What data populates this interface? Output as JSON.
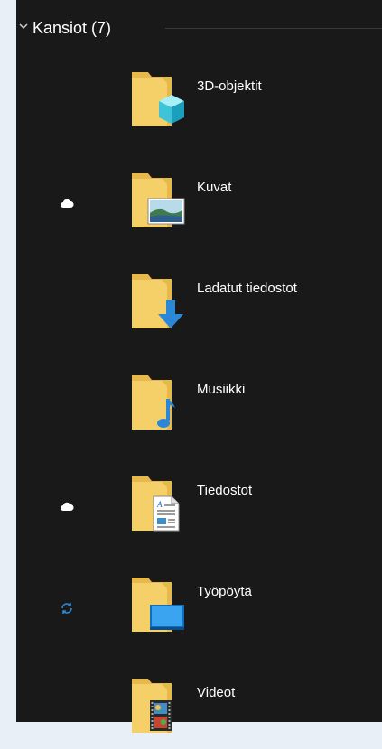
{
  "header": {
    "title": "Kansiot (7)"
  },
  "folders": [
    {
      "label": "3D-objektit",
      "overlay_icon": "cube-icon",
      "status_icon": null
    },
    {
      "label": "Kuvat",
      "overlay_icon": "picture-icon",
      "status_icon": "cloud-icon"
    },
    {
      "label": "Ladatut tiedostot",
      "overlay_icon": "download-arrow-icon",
      "status_icon": null
    },
    {
      "label": "Musiikki",
      "overlay_icon": "music-note-icon",
      "status_icon": null
    },
    {
      "label": "Tiedostot",
      "overlay_icon": "document-icon",
      "status_icon": "cloud-icon"
    },
    {
      "label": "Työpöytä",
      "overlay_icon": "desktop-icon",
      "status_icon": "sync-icon"
    },
    {
      "label": "Videot",
      "overlay_icon": "film-strip-icon",
      "status_icon": null
    }
  ],
  "colors": {
    "background": "#191919",
    "outer_background": "#e9eff6",
    "text": "#ffffff",
    "folder_yellow": "#f5cf68",
    "folder_back": "#e7b84a",
    "accent_blue": "#2b88d8"
  }
}
